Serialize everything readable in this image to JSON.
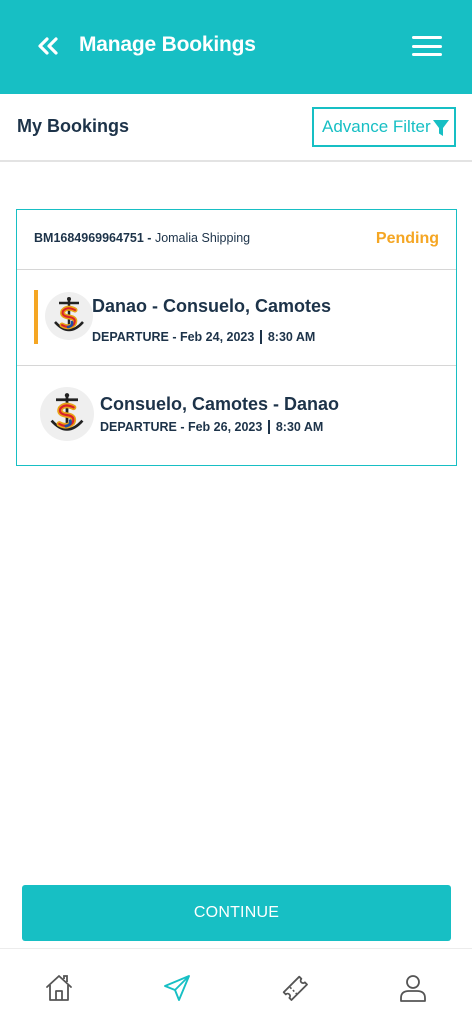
{
  "header": {
    "title": "Manage Bookings",
    "back_icon": "double-chevron-left-icon",
    "menu_icon": "hamburger-menu-icon"
  },
  "subbar": {
    "title": "My Bookings",
    "filter_label": "Advance Filter",
    "filter_icon": "funnel-icon"
  },
  "booking": {
    "id": "BM1684969964751",
    "separator": " - ",
    "company": "Jomalia Shipping",
    "status": "Pending",
    "trips": [
      {
        "route": "Danao - Consuelo, Camotes",
        "departure_label": "DEPARTURE - Feb 24, 2023",
        "time": "8:30 AM"
      },
      {
        "route": "Consuelo, Camotes - Danao",
        "departure_label": "DEPARTURE - Feb 26, 2023",
        "time": "8:30 AM"
      }
    ]
  },
  "actions": {
    "continue_label": "CONTINUE"
  },
  "nav": {
    "items": [
      "home-icon",
      "send-icon",
      "ticket-icon",
      "profile-icon"
    ]
  },
  "colors": {
    "primary": "#17bfc4",
    "pending": "#f5a623",
    "text": "#1d3349"
  }
}
